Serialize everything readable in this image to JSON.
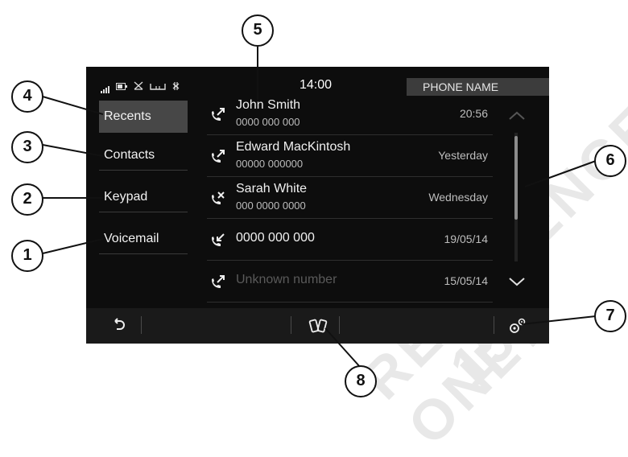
{
  "watermark": [
    "REFERENCE ONLY",
    "15"
  ],
  "status_bar": {
    "time": "14:00",
    "phone_name": "PHONE NAME",
    "icons": [
      "signal-strength-icon",
      "battery-icon",
      "network-off-icon",
      "voicemail-icon",
      "bluetooth-icon"
    ]
  },
  "nav": {
    "items": [
      {
        "label": "Recents",
        "active": true
      },
      {
        "label": "Contacts",
        "active": false
      },
      {
        "label": "Keypad",
        "active": false
      },
      {
        "label": "Voicemail",
        "active": false
      }
    ]
  },
  "calls": [
    {
      "name": "John Smith",
      "number": "0000 000 000",
      "when": "20:56",
      "type": "outgoing"
    },
    {
      "name": "Edward MacKintosh",
      "number": "00000 000000",
      "when": "Yesterday",
      "type": "outgoing"
    },
    {
      "name": "Sarah White",
      "number": "000 0000 0000",
      "when": "Wednesday",
      "type": "missed"
    },
    {
      "name": "0000 000 000",
      "number": "",
      "when": "19/05/14",
      "type": "incoming"
    },
    {
      "name": "Unknown number",
      "number": "",
      "when": "15/05/14",
      "type": "outgoing"
    }
  ],
  "bottom_bar": {
    "icons": [
      "back-icon",
      "phone-switch-icon",
      "settings-icon"
    ]
  },
  "callouts": [
    "1",
    "2",
    "3",
    "4",
    "5",
    "6",
    "7",
    "8"
  ],
  "colors": {
    "screen_bg": "#0d0d0d",
    "active_item": "#474747",
    "phone_name_bg": "#3c3c3c"
  }
}
